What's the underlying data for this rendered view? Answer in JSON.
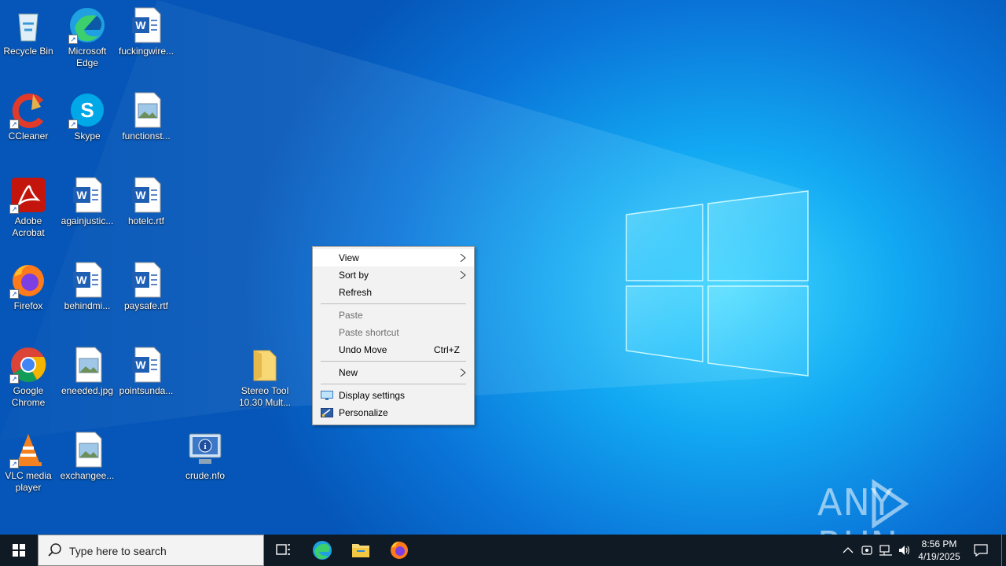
{
  "desktop": {
    "icons": [
      {
        "label": "Recycle Bin",
        "icon": "recycle-bin-icon"
      },
      {
        "label": "Microsoft Edge",
        "icon": "edge-icon"
      },
      {
        "label": "fuckingwire...",
        "icon": "word-document-icon"
      },
      {
        "label": "CCleaner",
        "icon": "ccleaner-icon"
      },
      {
        "label": "Skype",
        "icon": "skype-icon"
      },
      {
        "label": "functionst...",
        "icon": "image-file-icon"
      },
      {
        "label": "Adobe Acrobat",
        "icon": "acrobat-icon"
      },
      {
        "label": "againjustic...",
        "icon": "word-document-icon"
      },
      {
        "label": "hotelc.rtf",
        "icon": "word-document-icon"
      },
      {
        "label": "Firefox",
        "icon": "firefox-icon"
      },
      {
        "label": "behindmi...",
        "icon": "word-document-icon"
      },
      {
        "label": "paysafe.rtf",
        "icon": "word-document-icon"
      },
      {
        "label": "Google Chrome",
        "icon": "chrome-icon"
      },
      {
        "label": "eneeded.jpg",
        "icon": "image-file-icon"
      },
      {
        "label": "pointsunda...",
        "icon": "word-document-icon"
      },
      {
        "label": "Stereo Tool 10.30 Mult...",
        "icon": "folder-icon"
      },
      {
        "label": "VLC media player",
        "icon": "vlc-icon"
      },
      {
        "label": "exchangee...",
        "icon": "image-file-icon"
      },
      {
        "label": "crude.nfo",
        "icon": "system-info-icon"
      }
    ]
  },
  "context_menu": {
    "items": [
      {
        "label": "View",
        "has_submenu": true,
        "state": "highlighted"
      },
      {
        "label": "Sort by",
        "has_submenu": true
      },
      {
        "label": "Refresh"
      },
      {
        "label": "Paste",
        "state": "disabled"
      },
      {
        "label": "Paste shortcut",
        "state": "disabled"
      },
      {
        "label": "Undo Move",
        "shortcut": "Ctrl+Z"
      },
      {
        "label": "New",
        "has_submenu": true
      },
      {
        "label": "Display settings",
        "icon": "display-settings-icon"
      },
      {
        "label": "Personalize",
        "icon": "personalize-icon"
      }
    ]
  },
  "taskbar": {
    "search_placeholder": "Type here to search",
    "pinned": [
      "task-view-icon",
      "edge-icon",
      "file-explorer-icon",
      "firefox-icon"
    ],
    "clock": {
      "time": "8:56 PM",
      "date": "4/19/2025"
    }
  },
  "watermark": {
    "text": "ANY RUN"
  },
  "colors": {
    "taskbar": "#101a24",
    "menu_bg": "#f2f2f2",
    "accent": "#0078d7"
  }
}
